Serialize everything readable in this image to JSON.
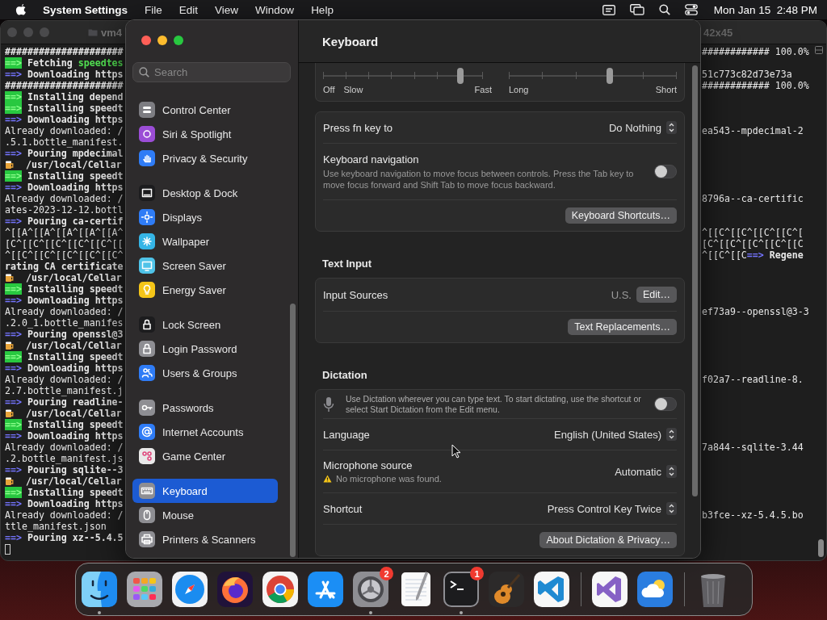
{
  "menu_bar": {
    "app_name": "System Settings",
    "menus": [
      "File",
      "Edit",
      "View",
      "Window",
      "Help"
    ],
    "clock": "Mon Jan 15  2:48 PM"
  },
  "terminal": {
    "title": "vm4",
    "size": "42x45",
    "lines": [
      {
        "kind": "hash",
        "text": "#####################",
        "right": "############ 100.0%"
      },
      {
        "kind": "green",
        "arrow": "==>",
        "text": "Fetching",
        "accent": "speedtes"
      },
      {
        "kind": "blue",
        "arrow": "==>",
        "text": "Downloading https",
        "right": "51c773c82d73e73a"
      },
      {
        "kind": "hash",
        "text": "#####################",
        "right": "############ 100.0%"
      },
      {
        "kind": "green",
        "arrow": "==>",
        "text": "Installing depend"
      },
      {
        "kind": "green",
        "arrow": "==>",
        "text": "Installing speedt"
      },
      {
        "kind": "blue",
        "arrow": "==>",
        "text": "Downloading https"
      },
      {
        "kind": "plain",
        "text": "Already downloaded: /",
        "right": "ea543--mpdecimal-2"
      },
      {
        "kind": "plain",
        "text": ".5.1.bottle_manifest."
      },
      {
        "kind": "blue",
        "arrow": "==>",
        "text": "Pouring mpdecimal"
      },
      {
        "kind": "beer",
        "text": "/usr/local/Cellar"
      },
      {
        "kind": "green",
        "arrow": "==>",
        "text": "Installing speedt"
      },
      {
        "kind": "blue",
        "arrow": "==>",
        "text": "Downloading https"
      },
      {
        "kind": "plain",
        "text": "Already downloaded: /",
        "right": "8796a--ca-certific"
      },
      {
        "kind": "plain",
        "text": "ates-2023-12-12.bottl"
      },
      {
        "kind": "blue",
        "arrow": "==>",
        "text": "Pouring ca-certif"
      },
      {
        "kind": "plain",
        "text": "^[[A^[[A^[[A^[[A^[[A^",
        "right": "^[[C^[[C^[[C^[[C^["
      },
      {
        "kind": "plain",
        "text": "[C^[[C^[[C^[[C^[[C^[[",
        "right": "[C^[[C^[[C^[[C^[[C"
      },
      {
        "kind": "plain",
        "text": "^[[C^[[C^[[C^[[C^[[C^",
        "right": "^[[C^[[C",
        "right_arrow": "==>",
        "right_bold": "Regene"
      },
      {
        "kind": "hash",
        "text": "rating CA certificate"
      },
      {
        "kind": "beer",
        "text": "/usr/local/Cellar"
      },
      {
        "kind": "green",
        "arrow": "==>",
        "text": "Installing speedt"
      },
      {
        "kind": "blue",
        "arrow": "==>",
        "text": "Downloading https"
      },
      {
        "kind": "plain",
        "text": "Already downloaded: /",
        "right": "ef73a9--openssl@3-3"
      },
      {
        "kind": "plain",
        "text": ".2.0_1.bottle_manifes"
      },
      {
        "kind": "blue",
        "arrow": "==>",
        "text": "Pouring openssl@3"
      },
      {
        "kind": "beer",
        "text": "/usr/local/Cellar"
      },
      {
        "kind": "green",
        "arrow": "==>",
        "text": "Installing speedt"
      },
      {
        "kind": "blue",
        "arrow": "==>",
        "text": "Downloading https"
      },
      {
        "kind": "plain",
        "text": "Already downloaded: /",
        "right": "f02a7--readline-8."
      },
      {
        "kind": "plain",
        "text": "2.7.bottle_manifest.j"
      },
      {
        "kind": "blue",
        "arrow": "==>",
        "text": "Pouring readline-"
      },
      {
        "kind": "beer",
        "text": "/usr/local/Cellar"
      },
      {
        "kind": "green",
        "arrow": "==>",
        "text": "Installing speedt"
      },
      {
        "kind": "blue",
        "arrow": "==>",
        "text": "Downloading https"
      },
      {
        "kind": "plain",
        "text": "Already downloaded: /",
        "right": "7a844--sqlite-3.44"
      },
      {
        "kind": "plain",
        "text": ".2.bottle_manifest.js"
      },
      {
        "kind": "blue",
        "arrow": "==>",
        "text": "Pouring sqlite--3"
      },
      {
        "kind": "beer",
        "text": "/usr/local/Cellar"
      },
      {
        "kind": "green",
        "arrow": "==>",
        "text": "Installing speedt"
      },
      {
        "kind": "blue",
        "arrow": "==>",
        "text": "Downloading https"
      },
      {
        "kind": "plain",
        "text": "Already downloaded: /",
        "right": "b3fce--xz-5.4.5.bo"
      },
      {
        "kind": "plain",
        "text": "ttle_manifest.json"
      },
      {
        "kind": "blue",
        "arrow": "==>",
        "text": "Pouring xz--5.4.5"
      },
      {
        "kind": "cursor"
      }
    ]
  },
  "settings": {
    "title": "Keyboard",
    "search": {
      "placeholder": "Search"
    },
    "sidebar": {
      "groups": [
        {
          "items": [
            {
              "label": "Control Center",
              "kind": "switches",
              "color": "#7d7d82",
              "selected": false
            },
            {
              "label": "Siri & Spotlight",
              "kind": "siri",
              "color": "#9b4dd6",
              "selected": false
            },
            {
              "label": "Privacy & Security",
              "kind": "hand",
              "color": "#2f7cf6",
              "selected": false
            }
          ]
        },
        {
          "items": [
            {
              "label": "Desktop & Dock",
              "kind": "dock",
              "color": "#1c1c1e",
              "selected": false
            },
            {
              "label": "Displays",
              "kind": "sun",
              "color": "#2f7cf6",
              "selected": false
            },
            {
              "label": "Wallpaper",
              "kind": "flower",
              "color": "#35b5e6",
              "selected": false
            },
            {
              "label": "Screen Saver",
              "kind": "screen",
              "color": "#4fc3e8",
              "selected": false
            },
            {
              "label": "Energy Saver",
              "kind": "bulb",
              "color": "#f5c518",
              "selected": false
            }
          ]
        },
        {
          "items": [
            {
              "label": "Lock Screen",
              "kind": "lock",
              "color": "#1c1c1e",
              "selected": false
            },
            {
              "label": "Login Password",
              "kind": "lock",
              "color": "#8e8e93",
              "selected": false
            },
            {
              "label": "Users & Groups",
              "kind": "people",
              "color": "#2f7cf6",
              "selected": false
            }
          ]
        },
        {
          "items": [
            {
              "label": "Passwords",
              "kind": "key",
              "color": "#8e8e93",
              "selected": false
            },
            {
              "label": "Internet Accounts",
              "kind": "at",
              "color": "#2f7cf6",
              "selected": false
            },
            {
              "label": "Game Center",
              "kind": "game",
              "color": "#e9e9e9",
              "selected": false
            }
          ]
        },
        {
          "items": [
            {
              "label": "Keyboard",
              "kind": "keyboard",
              "color": "#8e8e93",
              "selected": true
            },
            {
              "label": "Mouse",
              "kind": "mouse",
              "color": "#8e8e93",
              "selected": false
            },
            {
              "label": "Printers & Scanners",
              "kind": "printer",
              "color": "#8e8e93",
              "selected": false
            }
          ]
        }
      ]
    },
    "sections": [
      {
        "cards": [
          {
            "rows": [
              {
                "kind": "sliders",
                "sliders": [
                  {
                    "kind": "rate",
                    "start_label": "Off",
                    "low_label": "Slow",
                    "end_label": "Fast",
                    "level": 0.857
                  },
                  {
                    "kind": "delay",
                    "start_label": "Long",
                    "end_label": "Short",
                    "level": 0.6
                  }
                ]
              }
            ]
          },
          {
            "rows": [
              {
                "kind": "popup",
                "label": "Press fn key to",
                "value": "Do Nothing"
              },
              {
                "kind": "toggle",
                "label": "Keyboard navigation",
                "description": "Use keyboard navigation to move focus between controls. Press the Tab key to move focus forward and Shift Tab to move focus backward.",
                "on": false
              },
              {
                "kind": "button",
                "button": "Keyboard Shortcuts…"
              }
            ]
          }
        ]
      },
      {
        "heading": "Text Input",
        "cards": [
          {
            "rows": [
              {
                "kind": "value_button",
                "label": "Input Sources",
                "value": "U.S.",
                "button": "Edit…"
              },
              {
                "kind": "button",
                "button": "Text Replacements…"
              }
            ]
          }
        ]
      },
      {
        "heading": "Dictation",
        "cards": [
          {
            "rows": [
              {
                "kind": "mic_toggle",
                "description": "Use Dictation wherever you can type text. To start dictating, use the shortcut or select Start Dictation from the Edit menu.",
                "on": false
              },
              {
                "kind": "popup",
                "label": "Language",
                "value": "English (United States)"
              },
              {
                "kind": "popup",
                "label": "Microphone source",
                "value": "Automatic",
                "warning": "No microphone was found."
              },
              {
                "kind": "popup",
                "label": "Shortcut",
                "value": "Press Control Key Twice"
              },
              {
                "kind": "button",
                "button": "About Dictation & Privacy…"
              }
            ]
          }
        ]
      }
    ]
  },
  "dock": {
    "apps": [
      {
        "kind": "finder",
        "running": true
      },
      {
        "kind": "launchpad",
        "running": false
      },
      {
        "kind": "safari",
        "running": false
      },
      {
        "kind": "firefox",
        "running": false
      },
      {
        "kind": "chrome",
        "running": false
      },
      {
        "kind": "appstore",
        "running": false
      },
      {
        "kind": "settings",
        "running": true,
        "badge": "2"
      },
      {
        "kind": "textedit",
        "running": false
      },
      {
        "kind": "terminal",
        "running": true,
        "badge": "1"
      },
      {
        "kind": "garageband",
        "running": false
      },
      {
        "kind": "vscode",
        "running": false
      },
      {
        "kind": "separator"
      },
      {
        "kind": "visualstudio",
        "running": false
      },
      {
        "kind": "weather",
        "running": false
      },
      {
        "kind": "separator"
      },
      {
        "kind": "trash",
        "running": false
      }
    ]
  }
}
